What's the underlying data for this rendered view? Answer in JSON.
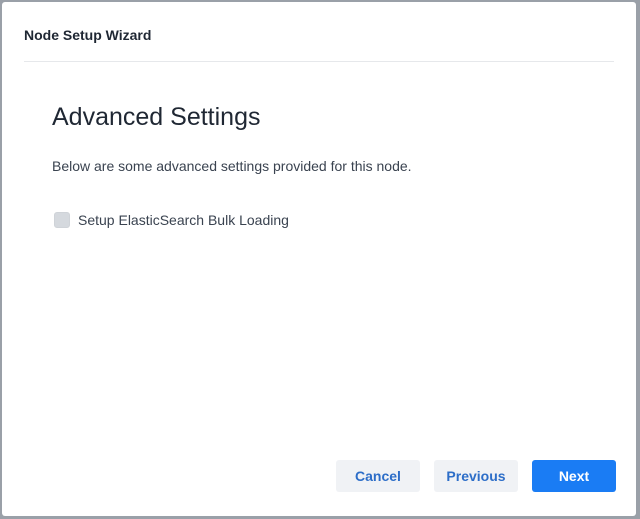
{
  "modal": {
    "title": "Node Setup Wizard",
    "heading": "Advanced Settings",
    "description": "Below are some advanced settings provided for this node.",
    "options": [
      {
        "label": "Setup ElasticSearch Bulk Loading",
        "checked": false
      }
    ]
  },
  "footer": {
    "cancel_label": "Cancel",
    "previous_label": "Previous",
    "next_label": "Next"
  },
  "colors": {
    "primary": "#1a7cf4",
    "secondary_bg": "#f0f2f5",
    "secondary_text": "#2d6ec8",
    "backdrop": "#9aa0a8"
  }
}
